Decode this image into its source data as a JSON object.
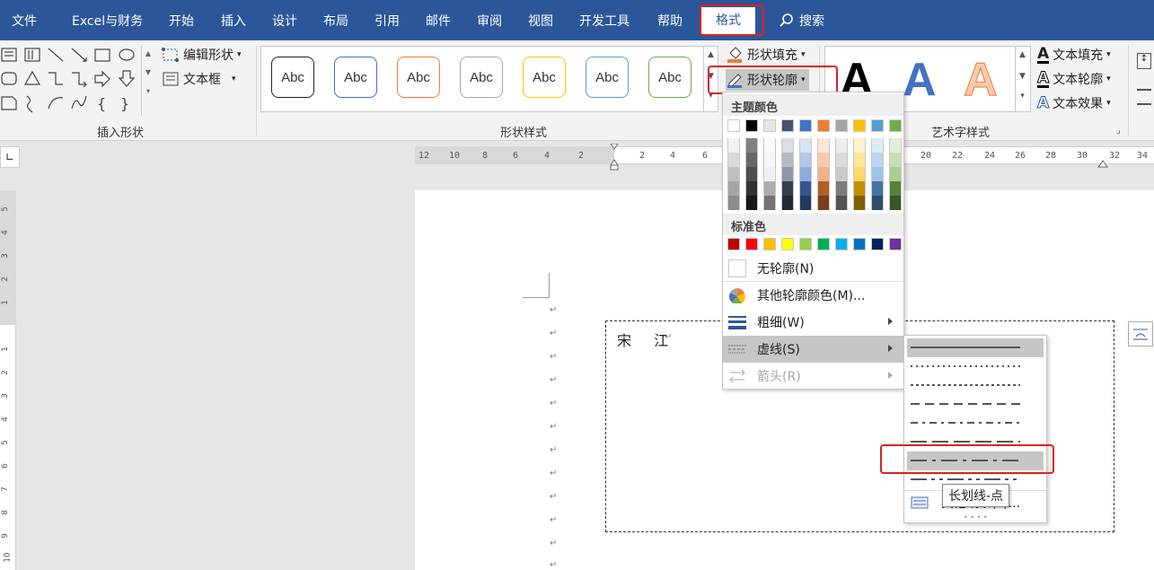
{
  "tabs": [
    "文件",
    "Excel与财务",
    "开始",
    "插入",
    "设计",
    "布局",
    "引用",
    "邮件",
    "审阅",
    "视图",
    "开发工具",
    "帮助",
    "格式"
  ],
  "search_label": "搜索",
  "ribbon": {
    "insert_shapes": {
      "edit_shape": "编辑形状",
      "text_box": "文本框",
      "label": "插入形状"
    },
    "shape_styles": {
      "abc": "Abc",
      "label": "形状样式",
      "fill": "形状填充",
      "outline": "形状轮廓"
    },
    "wordart": {
      "letter": "A",
      "label": "艺术字样式",
      "text_fill": "文本填充",
      "text_outline": "文本轮廓",
      "text_effect": "文本效果"
    }
  },
  "ruler_ticks": [
    "12",
    "10",
    "8",
    "6",
    "4",
    "2",
    "2",
    "4",
    "6",
    "20",
    "22",
    "24",
    "26",
    "28",
    "30",
    "32",
    "34"
  ],
  "vruler_ticks": [
    "5",
    "4",
    "3",
    "2",
    "1",
    "1",
    "2",
    "3",
    "4",
    "5",
    "6",
    "7",
    "8",
    "9",
    "10"
  ],
  "document": {
    "textbox_text": "宋 江",
    "para_mark": "↵"
  },
  "menu": {
    "theme_colors_header": "主题颜色",
    "standard_colors_header": "标准色",
    "no_outline": "无轮廓(N)",
    "more_colors": "其他轮廓颜色(M)...",
    "weight": "粗细(W)",
    "dashes": "虚线(S)",
    "arrows": "箭头(R)"
  },
  "submenu_more": "其他线条(L)...",
  "tooltip": "长划线-点",
  "colors": {
    "accent": "#2b579a",
    "theme_top": [
      "#ffffff",
      "#000000",
      "#e7e6e6",
      "#44546a",
      "#4472c4",
      "#ed7d31",
      "#a5a5a5",
      "#ffc000",
      "#5b9bd5",
      "#70ad47"
    ],
    "standard": [
      "#c00000",
      "#ff0000",
      "#ffc000",
      "#ffff00",
      "#92d050",
      "#00b050",
      "#00b0f0",
      "#0070c0",
      "#002060",
      "#7030a0"
    ]
  }
}
